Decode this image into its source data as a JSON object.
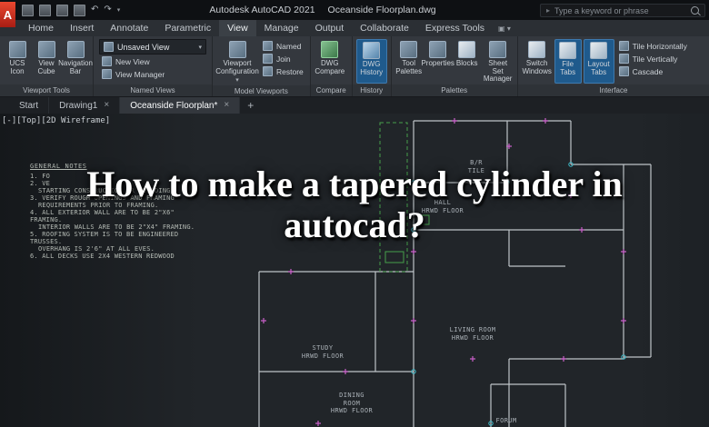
{
  "titlebar": {
    "logo": "A",
    "app_title": "Autodesk AutoCAD 2021",
    "doc_title": "Oceanside Floorplan.dwg",
    "search_placeholder": "Type a keyword or phrase"
  },
  "ribbon_tabs": [
    "Home",
    "Insert",
    "Annotate",
    "Parametric",
    "View",
    "Manage",
    "Output",
    "Collaborate",
    "Express Tools"
  ],
  "panels": {
    "viewport_tools": {
      "name": "Viewport Tools",
      "ucs": "UCS Icon",
      "viewcube": "View Cube",
      "navbar": "Navigation Bar"
    },
    "named_views": {
      "name": "Named Views",
      "dropdown_value": "Unsaved View",
      "new_view": "New View",
      "view_manager": "View Manager"
    },
    "model_viewports": {
      "name": "Model Viewports",
      "config": "Viewport Configuration",
      "named": "Named",
      "join": "Join",
      "restore": "Restore"
    },
    "compare": {
      "name": "Compare",
      "dwg_compare": "DWG Compare"
    },
    "history": {
      "name": "History",
      "dwg_history": "DWG History"
    },
    "palettes": {
      "name": "Palettes",
      "tool_palettes": "Tool Palettes",
      "properties": "Properties",
      "blocks": "Blocks",
      "sheet_set": "Sheet Set Manager"
    },
    "interface": {
      "name": "Interface",
      "switch_windows": "Switch Windows",
      "file_tabs": "File Tabs",
      "layout_tabs": "Layout Tabs",
      "tile_h": "Tile Horizontally",
      "tile_v": "Tile Vertically",
      "cascade": "Cascade"
    }
  },
  "file_tabs": {
    "start": "Start",
    "drawing1": "Drawing1",
    "oceanside": "Oceanside Floorplan*",
    "close": "×",
    "add": "+"
  },
  "viewport": {
    "controls": "[-][Top][2D Wireframe]"
  },
  "overlay": {
    "title": "How to make a tapered cylinder in autocad?"
  },
  "notes": {
    "heading": "GENERAL NOTES",
    "lines": [
      "1. FO",
      "2. VE",
      "STARTING CONSTRUCTION OR BUILDING.",
      "3. VERIFY ROUGH OPENINGS AND FRAMING",
      "REQUIREMENTS PRIOR TO FRAMING.",
      "4. ALL EXTERIOR WALL ARE TO BE 2\"X6\" FRAMING.",
      "INTERIOR WALLS ARE TO BE 2\"X4\" FRAMING.",
      "5. ROOFING SYSTEM IS TO BE ENGINEERED TRUSSES.",
      "OVERHANG IS 2'6\" AT ALL EVES.",
      "6. ALL DECKS USE 2X4 WESTERN REDWOOD"
    ]
  },
  "rooms": {
    "br": "B/R",
    "br_floor": "TILE",
    "hall": "HALL",
    "hall_floor": "HRWD FLOOR",
    "living": "LIVING ROOM",
    "living_floor": "HRWD FLOOR",
    "study": "STUDY",
    "study_floor": "HRWD FLOOR",
    "dining_l1": "DINING",
    "dining_l2": "ROOM",
    "dining_floor": "HRWD FLOOR",
    "forum": "FORUM"
  },
  "colors": {
    "highlight_blue": "#1f5a8c",
    "logo_red": "#cf3a2b",
    "canvas_bg": "#212529",
    "wall_line": "#ccd1d6"
  }
}
